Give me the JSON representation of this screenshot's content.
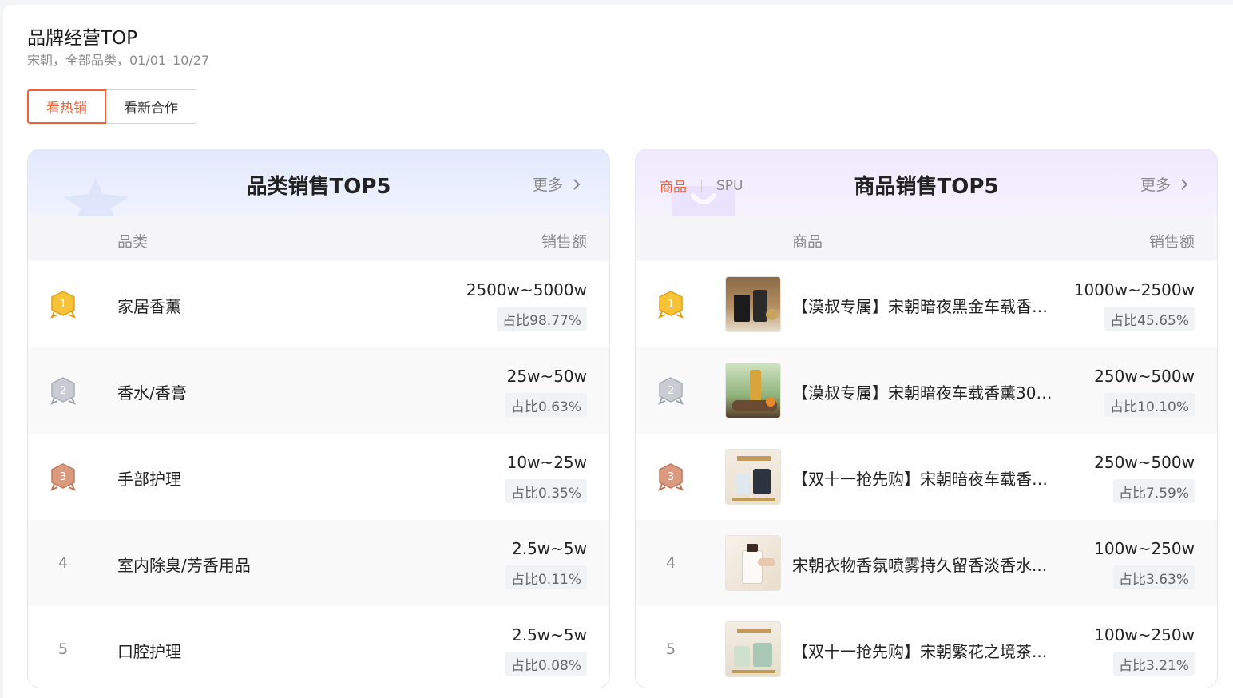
{
  "header": {
    "title": "品牌经营TOP",
    "subtitle": "宋朝，全部品类，01/01–10/27"
  },
  "tabs": [
    {
      "label": "看热销",
      "active": true
    },
    {
      "label": "看新合作",
      "active": false
    }
  ],
  "accent_color": "#f0613b",
  "category_card": {
    "title": "品类销售TOP5",
    "more_label": "更多",
    "col_category": "品类",
    "col_sales": "销售额",
    "rows": [
      {
        "rank": "1",
        "rank_icon": "gold-medal-icon",
        "name": "家居香薰",
        "amount": "2500w~5000w",
        "share": "占比98.77%"
      },
      {
        "rank": "2",
        "rank_icon": "silver-medal-icon",
        "name": "香水/香膏",
        "amount": "25w~50w",
        "share": "占比0.63%"
      },
      {
        "rank": "3",
        "rank_icon": "bronze-medal-icon",
        "name": "手部护理",
        "amount": "10w~25w",
        "share": "占比0.35%"
      },
      {
        "rank": "4",
        "name": "室内除臭/芳香用品",
        "amount": "2.5w~5w",
        "share": "占比0.11%"
      },
      {
        "rank": "5",
        "name": "口腔护理",
        "amount": "2.5w~5w",
        "share": "占比0.08%"
      }
    ]
  },
  "product_card": {
    "title": "商品销售TOP5",
    "more_label": "更多",
    "switch_on": "商品",
    "switch_off": "SPU",
    "col_product": "商品",
    "col_sales": "销售额",
    "rows": [
      {
        "rank": "1",
        "rank_icon": "gold-medal-icon",
        "name": "【漠叔专属】宋朝暗夜黑金车载香薰...",
        "amount": "1000w~2500w",
        "share": "占比45.65%"
      },
      {
        "rank": "2",
        "rank_icon": "silver-medal-icon",
        "name": "【漠叔专属】宋朝暗夜车载香薰30ml...",
        "amount": "250w~500w",
        "share": "占比10.10%"
      },
      {
        "rank": "3",
        "rank_icon": "bronze-medal-icon",
        "name": "【双十一抢先购】宋朝暗夜车载香薰...",
        "amount": "250w~500w",
        "share": "占比7.59%"
      },
      {
        "rank": "4",
        "name": "宋朝衣物香氛喷雾持久留香淡香水...",
        "amount": "100w~250w",
        "share": "占比3.63%"
      },
      {
        "rank": "5",
        "name": "【双十一抢先购】宋朝繁花之境茶...",
        "amount": "100w~250w",
        "share": "占比3.21%"
      }
    ]
  }
}
